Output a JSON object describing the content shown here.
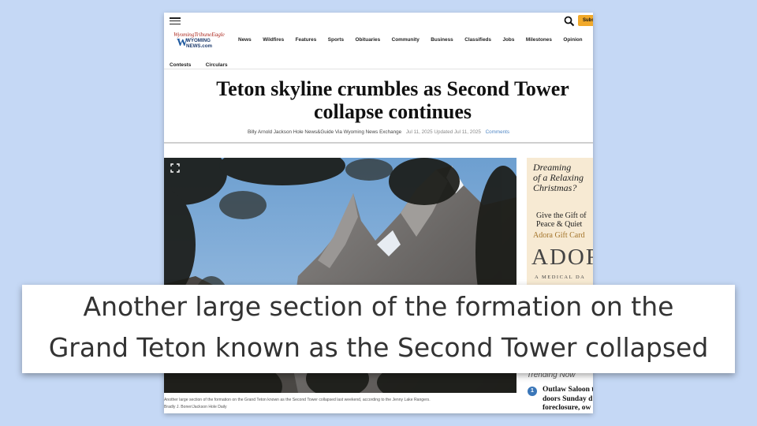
{
  "header": {
    "subscribe_label": "Subscribe",
    "logo_line1": "WyomingTribuneEagle",
    "logo_mark": "W",
    "logo_line2": "WYOMING",
    "logo_line3": "NEWS.com"
  },
  "nav": {
    "items": [
      "News",
      "Wildfires",
      "Features",
      "Sports",
      "Obituaries",
      "Community",
      "Business",
      "Classifieds",
      "Jobs",
      "Milestones",
      "Opinion"
    ],
    "items_row2": [
      "Contests",
      "Circulars"
    ]
  },
  "article": {
    "headline_line1": "Teton skyline crumbles as Second Tower",
    "headline_line2": "collapse continues",
    "byline": "Billy Arnold Jackson Hole News&Guide Via Wyoming News Exchange",
    "dates": "Jul 11, 2025 Updated Jul 11, 2025",
    "comments_label": "Comments",
    "caption": "Another large section of the formation on the Grand Teton known as the Second Tower collapsed last weekend, according to the Jenny Lake Rangers.",
    "photo_credit": "Bradly J. Boner/Jackson Hole Daily"
  },
  "ad": {
    "script_line1": "Dreaming",
    "script_line2": "of a Relaxing",
    "script_line3": "Christmas?",
    "gift_line1": "Give the Gift of",
    "gift_line2": "Peace & Quiet",
    "gift_card": "Adora Gift Card",
    "brand": "ADOR",
    "tagline": "A MEDICAL DA"
  },
  "trending": {
    "heading": "Trending Now",
    "item_number": "1",
    "item_line1": "Outlaw Saloon t",
    "item_line2": "doors Sunday d",
    "item_line3": "foreclosure, ow"
  },
  "zoom_caption": {
    "line1": "Another large section of the formation on the",
    "line2": "Grand Teton known as the Second Tower collapsed"
  },
  "colors": {
    "background": "#c5d8f5",
    "subscribe": "#f1a92a",
    "link": "#4f86c4",
    "trend_badge": "#3a76b8"
  }
}
